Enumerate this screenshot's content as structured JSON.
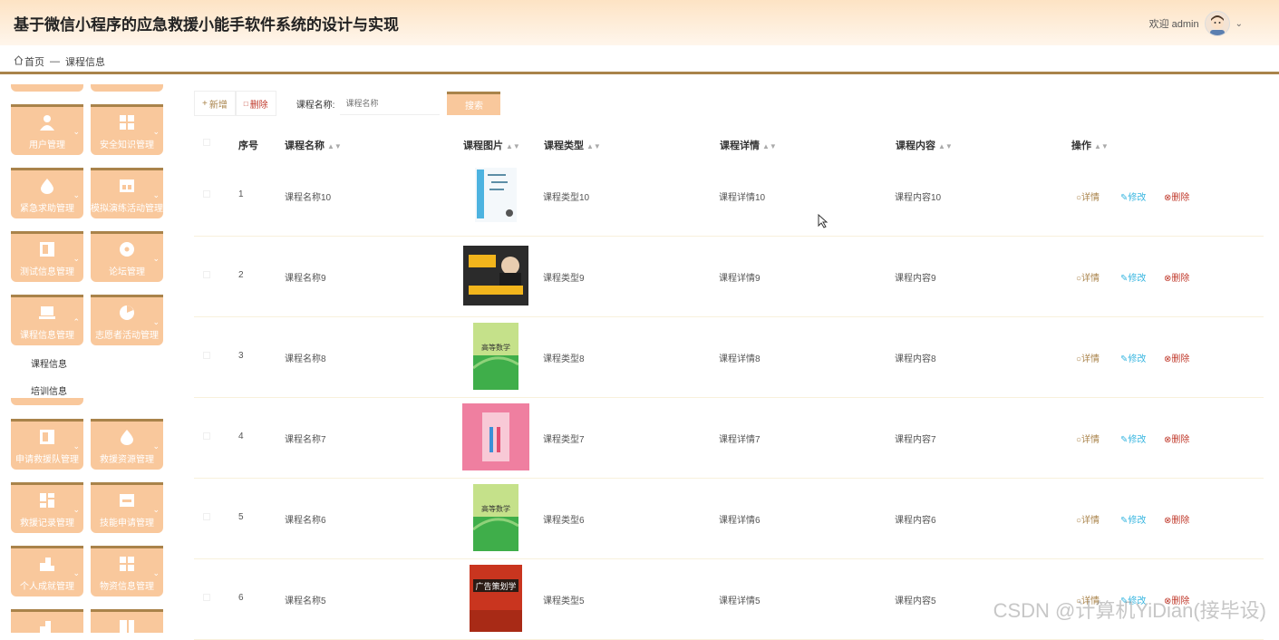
{
  "app": {
    "title": "基于微信小程序的应急救援小能手软件系统的设计与实现",
    "welcome": "欢迎 admin"
  },
  "breadcrumb": {
    "home": "首页",
    "separator": "—",
    "current": "课程信息"
  },
  "sidebar": {
    "tiles": [
      {
        "label": "用户管理",
        "icon": "user-icon"
      },
      {
        "label": "安全知识管理",
        "icon": "grid-icon"
      },
      {
        "label": "紧急求助管理",
        "icon": "drop-icon"
      },
      {
        "label": "模拟演练活动管理",
        "icon": "store-icon"
      },
      {
        "label": "测试信息管理",
        "icon": "panel-icon"
      },
      {
        "label": "论坛管理",
        "icon": "disc-icon"
      },
      {
        "label": "课程信息管理",
        "icon": "laptop-icon"
      },
      {
        "label": "志愿者活动管理",
        "icon": "pie-icon"
      },
      {
        "label": "申请救援队管理",
        "icon": "panel-icon"
      },
      {
        "label": "救援资源管理",
        "icon": "drop-icon"
      },
      {
        "label": "救援记录管理",
        "icon": "grid-icon"
      },
      {
        "label": "技能申请管理",
        "icon": "store-icon"
      },
      {
        "label": "个人成就管理",
        "icon": "bars-icon"
      },
      {
        "label": "物资信息管理",
        "icon": "grid-icon"
      }
    ],
    "submenu": [
      "课程信息",
      "培训信息"
    ]
  },
  "toolbar": {
    "add_label": "新增",
    "delete_label": "删除",
    "search_label": "课程名称:",
    "search_placeholder": "课程名称",
    "search_button": "搜索"
  },
  "table": {
    "headers": {
      "index": "序号",
      "name": "课程名称",
      "image": "课程图片",
      "type": "课程类型",
      "detail": "课程详情",
      "content": "课程内容",
      "actions": "操作"
    },
    "actions": {
      "detail": "详情",
      "edit": "修改",
      "delete": "删除"
    },
    "rows": [
      {
        "index": "1",
        "name": "课程名称10",
        "type": "课程类型10",
        "detail": "课程详情10",
        "content": "课程内容10",
        "cover": "book-cover-poetry"
      },
      {
        "index": "2",
        "name": "课程名称9",
        "type": "课程类型9",
        "detail": "课程详情9",
        "content": "课程内容9",
        "cover": "book-cover-dark"
      },
      {
        "index": "3",
        "name": "课程名称8",
        "type": "课程类型8",
        "detail": "课程详情8",
        "content": "课程内容8",
        "cover": "book-cover-math",
        "cover_text": "高等数学"
      },
      {
        "index": "4",
        "name": "课程名称7",
        "type": "课程类型7",
        "detail": "课程详情7",
        "content": "课程内容7",
        "cover": "book-cover-pink"
      },
      {
        "index": "5",
        "name": "课程名称6",
        "type": "课程类型6",
        "detail": "课程详情6",
        "content": "课程内容6",
        "cover": "book-cover-math",
        "cover_text": "高等数学"
      },
      {
        "index": "6",
        "name": "课程名称5",
        "type": "课程类型5",
        "detail": "课程详情5",
        "content": "课程内容5",
        "cover": "book-cover-ad",
        "cover_text": "广告策划学"
      }
    ]
  },
  "watermark": "CSDN @计算机YiDian(接毕设)",
  "colors": {
    "accent": "#a9834a",
    "tile": "#f9c89c",
    "edit": "#38b6e0",
    "delete": "#c0392b"
  }
}
